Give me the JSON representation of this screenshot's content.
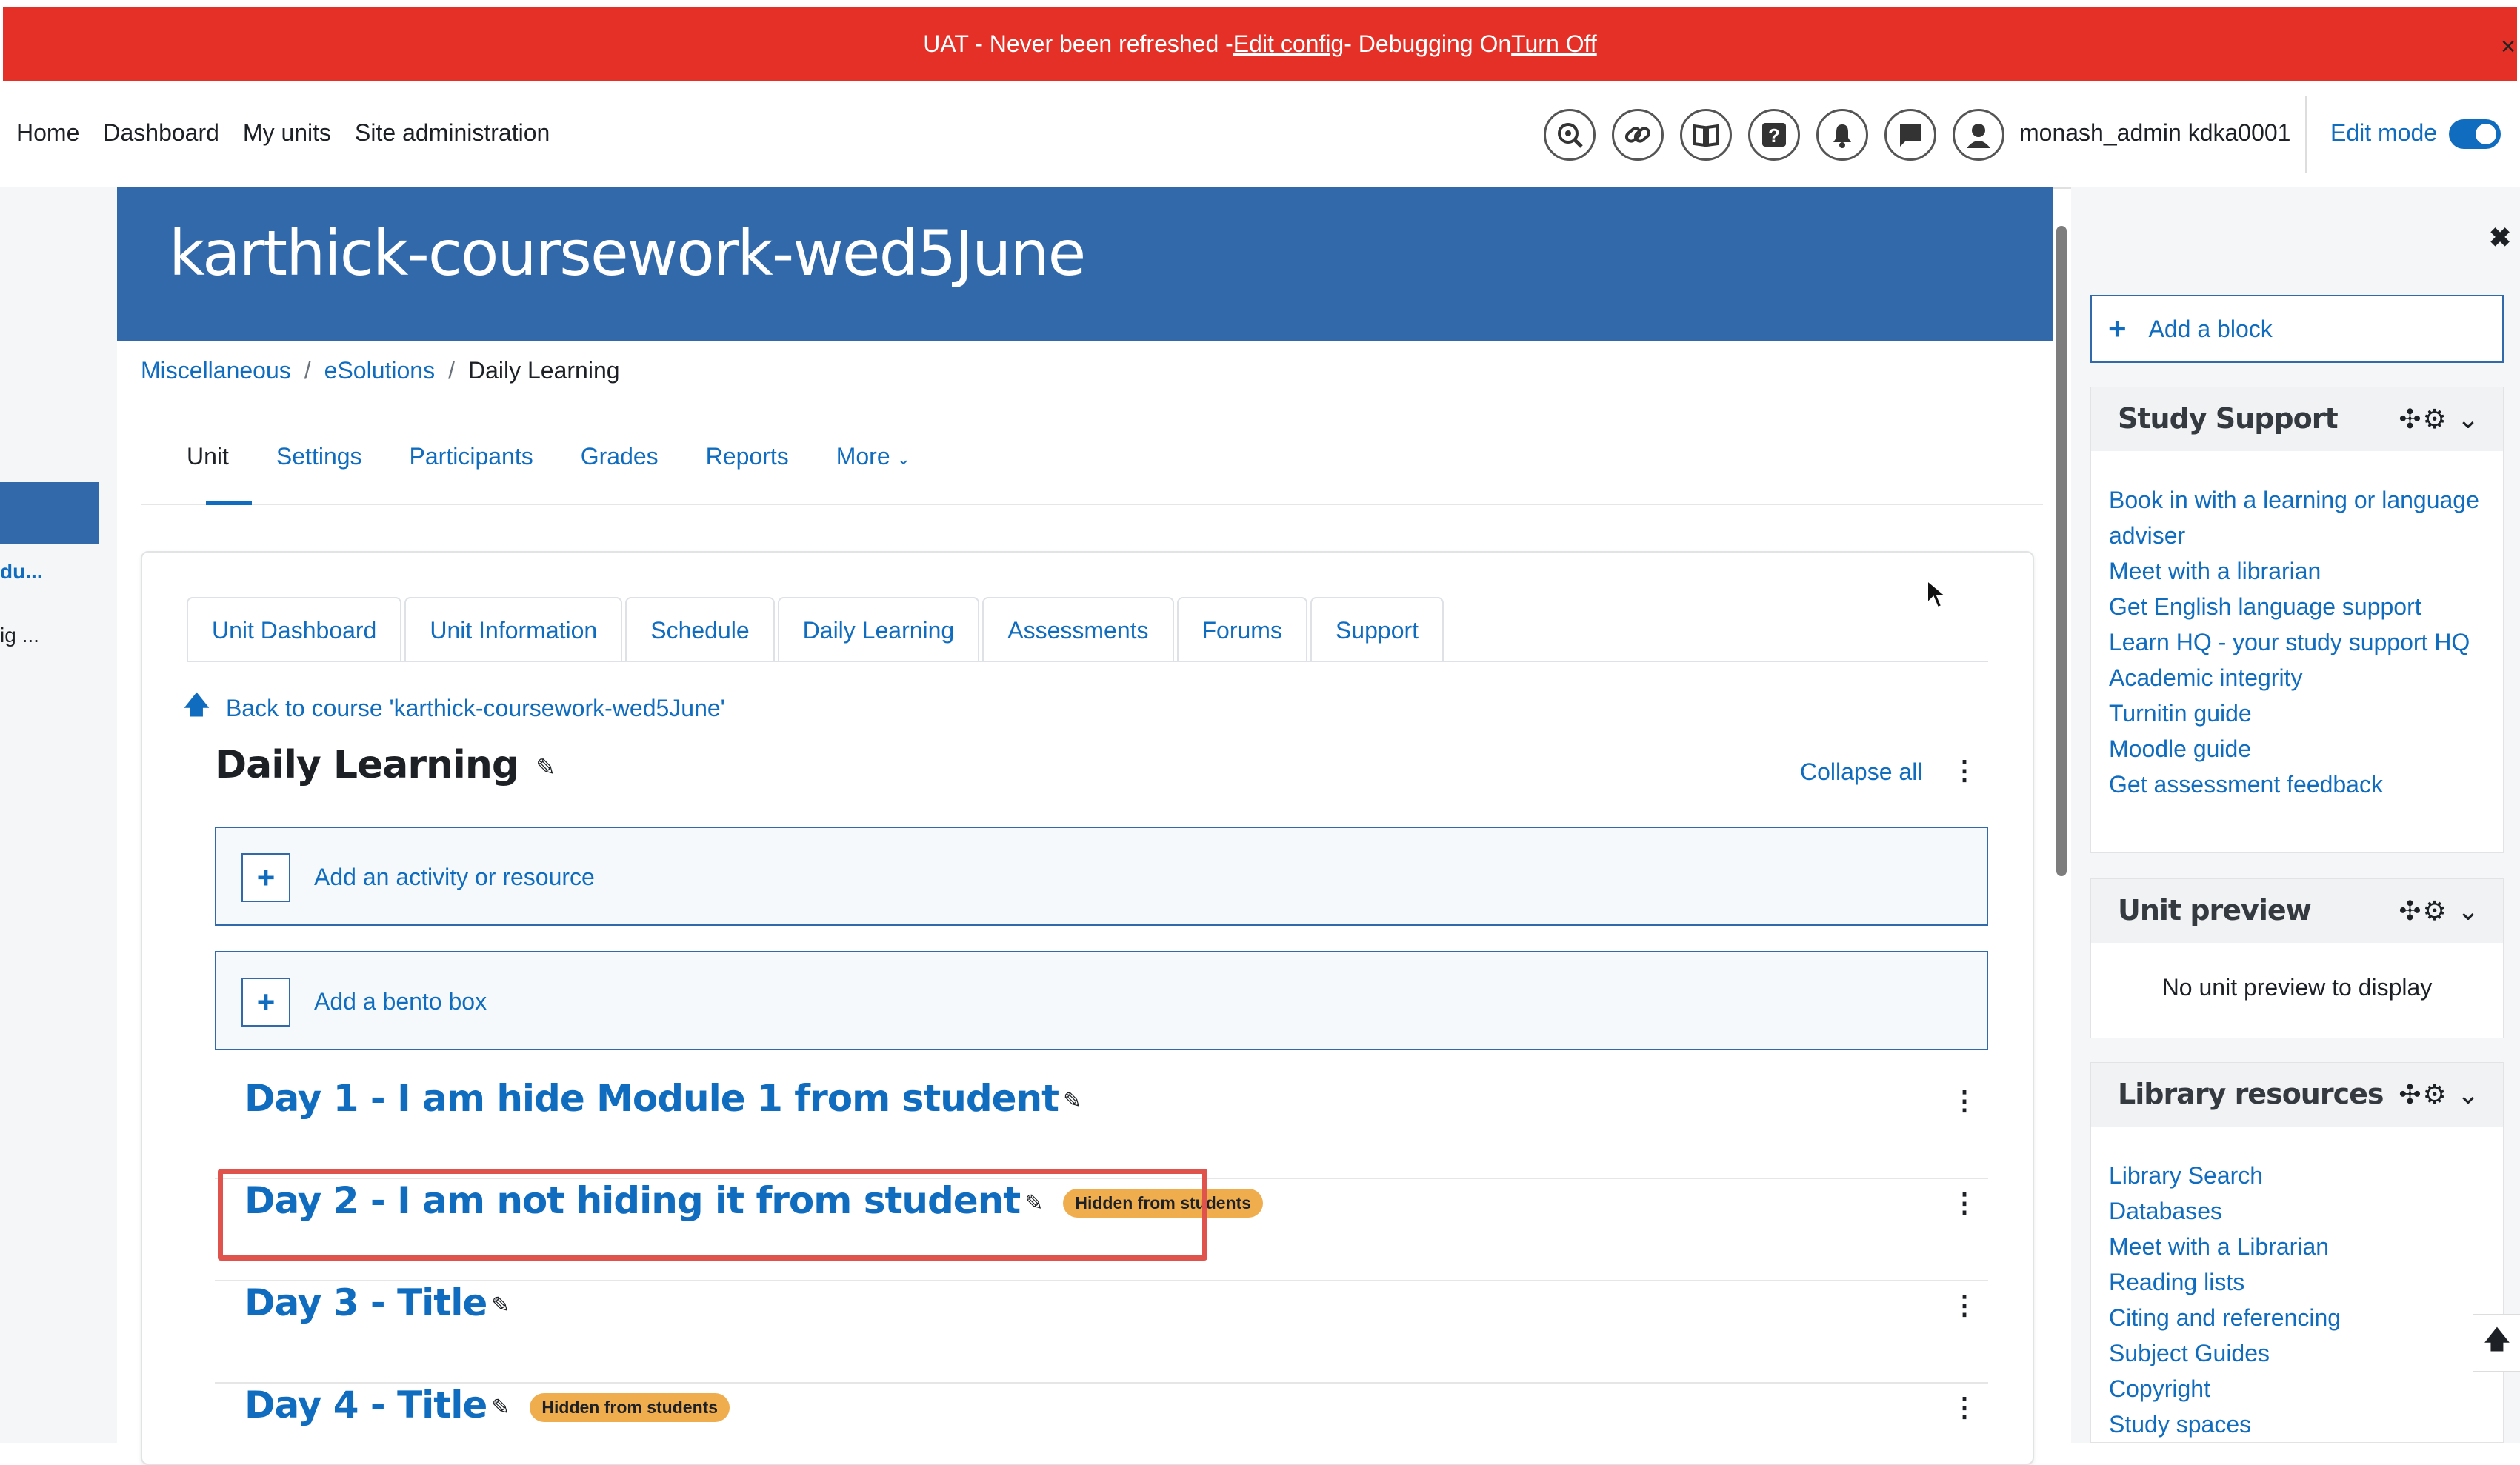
{
  "banner": {
    "prefix": "UAT - Never been refreshed - ",
    "edit_config": "Edit config",
    "middle": " - Debugging On ",
    "turn_off": "Turn Off",
    "close": "×"
  },
  "navbar": {
    "links": [
      "Home",
      "Dashboard",
      "My units",
      "Site administration"
    ],
    "icons": [
      "search-eye-icon",
      "link-icon",
      "book-icon",
      "help-icon",
      "bell-icon",
      "chat-icon",
      "avatar-icon"
    ],
    "username": "monash_admin kdka0001",
    "edit_mode_label": "Edit mode",
    "edit_mode_on": true
  },
  "left_drawer": {
    "items": [
      "du...",
      "ig ..."
    ]
  },
  "course": {
    "title": "karthick-coursework-wed5June",
    "breadcrumb": [
      "Miscellaneous",
      "eSolutions",
      "Daily Learning"
    ],
    "tabs": [
      "Unit",
      "Settings",
      "Participants",
      "Grades",
      "Reports",
      "More"
    ],
    "active_tab": "Unit"
  },
  "unit_tabs": [
    "Unit Dashboard",
    "Unit Information",
    "Schedule",
    "Daily Learning",
    "Assessments",
    "Forums",
    "Support"
  ],
  "back_link": "Back to course 'karthick-coursework-wed5June'",
  "section": {
    "title": "Daily Learning",
    "collapse_all": "Collapse all",
    "add_activity": "Add an activity or resource",
    "add_bento": "Add a bento box"
  },
  "days": [
    {
      "title": "Day 1 - I am hide Module 1 from student",
      "badge": ""
    },
    {
      "title": "Day 2 - I am not hiding it from student",
      "badge": "Hidden from students"
    },
    {
      "title": "Day 3 - Title",
      "badge": ""
    },
    {
      "title": "Day 4 - Title",
      "badge": "Hidden from students"
    }
  ],
  "right_drawer": {
    "add_block": "Add a block",
    "study_support": {
      "title": "Study Support",
      "links": [
        "Book in with a learning or language",
        "adviser",
        "Meet with a librarian",
        "Get English language support",
        "Learn HQ - your study support HQ",
        "Academic integrity",
        "Turnitin guide",
        "Moodle guide",
        "Get assessment feedback"
      ]
    },
    "unit_preview": {
      "title": "Unit preview",
      "empty": "No unit preview to display"
    },
    "library": {
      "title": "Library resources",
      "links": [
        "Library Search",
        "Databases",
        "Meet with a Librarian",
        "Reading lists",
        "Citing and referencing",
        "Subject Guides",
        "Copyright",
        "Study spaces"
      ]
    }
  },
  "colors": {
    "banner_red": "#e43026",
    "brand_blue": "#3169aa",
    "link_blue": "#0f6cbf",
    "badge_orange": "#f0ad4e",
    "highlight_red": "#e0524c"
  }
}
